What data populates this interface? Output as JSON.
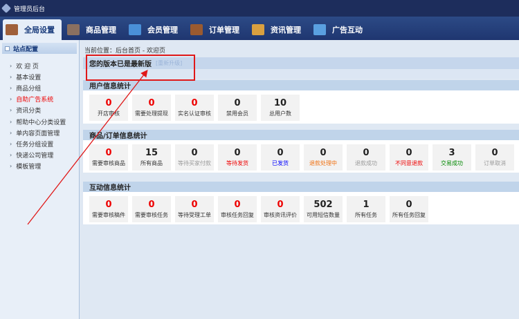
{
  "app_title": "管理员后台",
  "nav": [
    {
      "label": "全局设置",
      "active": true,
      "color": "#a0603a"
    },
    {
      "label": "商品管理",
      "color": "#8a7060"
    },
    {
      "label": "会员管理",
      "color": "#4a90d8"
    },
    {
      "label": "订单管理",
      "color": "#9a5a30"
    },
    {
      "label": "资讯管理",
      "color": "#d9a040"
    },
    {
      "label": "广告互动",
      "color": "#5aa0e0"
    }
  ],
  "sidebar": {
    "title": "站点配置",
    "items": [
      "欢 迎 页",
      "基本设置",
      "商品分组",
      "自助广告系统",
      "资讯分类",
      "帮助中心分类设置",
      "单内容页面管理",
      "任务分组设置",
      "快递公司管理",
      "模板管理"
    ],
    "active_index": 3
  },
  "breadcrumb": "当前位置：后台首页 - 欢迎页",
  "version": {
    "text": "您的版本已是最新版",
    "upgrade": "[重新升级]"
  },
  "sections": [
    {
      "title": "用户信息统计",
      "cards": [
        {
          "value": "0",
          "label": "开店审核",
          "vc": "#e00",
          "lc": "#333"
        },
        {
          "value": "0",
          "label": "需要处理提现",
          "vc": "#e00",
          "lc": "#333"
        },
        {
          "value": "0",
          "label": "实名认证审核",
          "vc": "#e00",
          "lc": "#333"
        },
        {
          "value": "0",
          "label": "禁用会员",
          "vc": "#222",
          "lc": "#333"
        },
        {
          "value": "10",
          "label": "总用户数",
          "vc": "#222",
          "lc": "#333"
        }
      ]
    },
    {
      "title": "商品/订单信息统计",
      "cards": [
        {
          "value": "0",
          "label": "需要审核商品",
          "vc": "#e00",
          "lc": "#333"
        },
        {
          "value": "15",
          "label": "所有商品",
          "vc": "#222",
          "lc": "#333"
        },
        {
          "value": "0",
          "label": "等待买家付款",
          "vc": "#222",
          "lc": "#999"
        },
        {
          "value": "0",
          "label": "等待发货",
          "vc": "#222",
          "lc": "#e00"
        },
        {
          "value": "0",
          "label": "已发货",
          "vc": "#222",
          "lc": "#00f"
        },
        {
          "value": "0",
          "label": "退款处理中",
          "vc": "#222",
          "lc": "#f07010"
        },
        {
          "value": "0",
          "label": "退款成功",
          "vc": "#222",
          "lc": "#999"
        },
        {
          "value": "0",
          "label": "不同意退款",
          "vc": "#222",
          "lc": "#e00"
        },
        {
          "value": "3",
          "label": "交易成功",
          "vc": "#222",
          "lc": "#080"
        },
        {
          "value": "0",
          "label": "订单取消",
          "vc": "#222",
          "lc": "#999"
        }
      ]
    },
    {
      "title": "互动信息统计",
      "cards": [
        {
          "value": "0",
          "label": "需要审核稿件",
          "vc": "#e00",
          "lc": "#333"
        },
        {
          "value": "0",
          "label": "需要审核任务",
          "vc": "#e00",
          "lc": "#333"
        },
        {
          "value": "0",
          "label": "等待受理工单",
          "vc": "#e00",
          "lc": "#333"
        },
        {
          "value": "0",
          "label": "审核任务回复",
          "vc": "#e00",
          "lc": "#333"
        },
        {
          "value": "0",
          "label": "审核资讯评价",
          "vc": "#e00",
          "lc": "#333"
        },
        {
          "value": "502",
          "label": "可用短信数量",
          "vc": "#222",
          "lc": "#333"
        },
        {
          "value": "1",
          "label": "所有任务",
          "vc": "#222",
          "lc": "#333"
        },
        {
          "value": "0",
          "label": "所有任务回复",
          "vc": "#222",
          "lc": "#333"
        }
      ]
    }
  ]
}
